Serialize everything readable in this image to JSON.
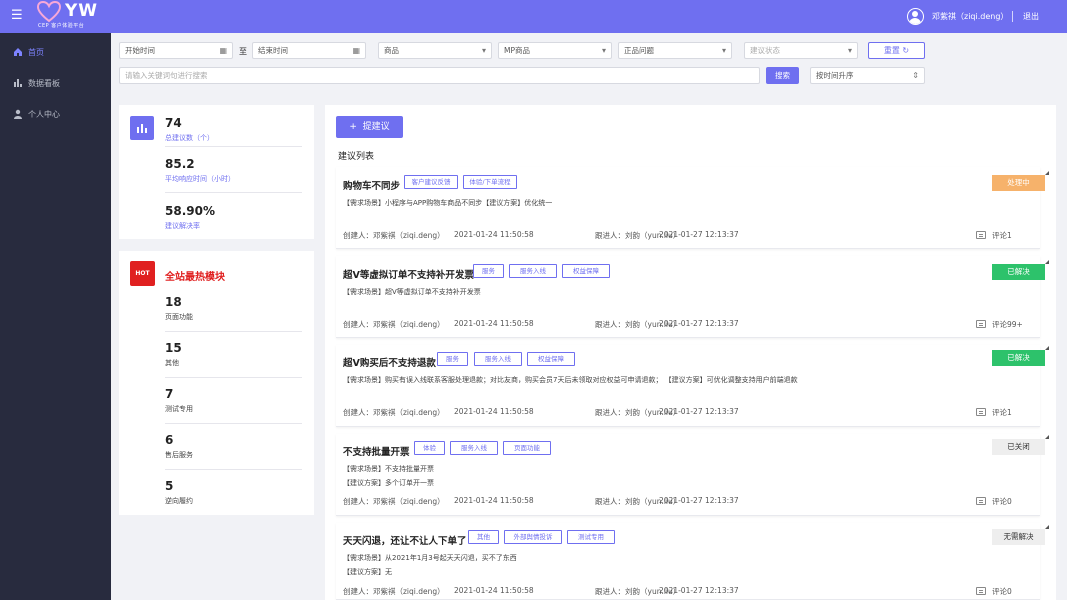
{
  "header": {
    "logo_text": "YW",
    "logo_sub": "CEP 客户体验平台",
    "user_name": "邓紫祺（ziqi.deng）",
    "logout": "退出"
  },
  "sidebar": {
    "items": [
      {
        "label": "首页",
        "icon": "home-icon",
        "active": true
      },
      {
        "label": "数据看板",
        "icon": "bar-chart-icon",
        "active": false
      },
      {
        "label": "个人中心",
        "icon": "user-icon",
        "active": false
      }
    ]
  },
  "filters": {
    "start_time": "开始时间",
    "to": "至",
    "end_time": "结束时间",
    "product": "商品",
    "mp_product": "MP商品",
    "issue_type": "正品问题",
    "status_placeholder": "建议状态",
    "reset": "重置",
    "search_placeholder": "请输入关键词句进行搜索",
    "search": "搜索",
    "sort": "按时间升序"
  },
  "stats": {
    "items": [
      {
        "value": "74",
        "label": "总建议数（个）"
      },
      {
        "value": "85.2",
        "label": "平均响应时间（小时）"
      },
      {
        "value": "58.90%",
        "label": "建议解决率"
      }
    ]
  },
  "hot": {
    "badge": "HOT",
    "title": "全站最热模块",
    "items": [
      {
        "value": "18",
        "label": "页面功能"
      },
      {
        "value": "15",
        "label": "其他"
      },
      {
        "value": "7",
        "label": "测试专用"
      },
      {
        "value": "6",
        "label": "售后服务"
      },
      {
        "value": "5",
        "label": "逆向履约"
      }
    ]
  },
  "list": {
    "add_button": "提建议",
    "title": "建议列表",
    "cards": [
      {
        "title": "购物车不同步",
        "tags": [
          "客户建议反馈",
          "体验/下单流程"
        ],
        "lines": [
          "【需求场景】小程序与APP购物车商品不同步【建议方案】优化统一"
        ],
        "creator": "创建人：邓紫祺（ziqi.deng）",
        "created": "2021-01-24  11:50:58",
        "follower": "跟进人：刘韵（yun.liu）",
        "followed": "2021-01-27  12:13:37",
        "comments": "评论1",
        "status": "处理中",
        "status_type": "processing"
      },
      {
        "title": "超V等虚拟订单不支持补开发票",
        "tags": [
          "服务",
          "服务入线",
          "权益保障"
        ],
        "lines": [
          "【需求场景】超V等虚拟订单不支持补开发票"
        ],
        "creator": "创建人：邓紫祺（ziqi.deng）",
        "created": "2021-01-24  11:50:58",
        "follower": "跟进人：刘韵（yun.liu）",
        "followed": "2021-01-27  12:13:37",
        "comments": "评论99+",
        "status": "已解决",
        "status_type": "solved"
      },
      {
        "title": "超V购买后不支持退款",
        "tags": [
          "服务",
          "服务入线",
          "权益保障"
        ],
        "lines": [
          "【需求场景】购买有误入线联系客服处理退款；对比友商，购买会员7天后未领取对应权益可申请退款；  【建议方案】可优化调整支持用户前端退款"
        ],
        "creator": "创建人：邓紫祺（ziqi.deng）",
        "created": "2021-01-24  11:50:58",
        "follower": "跟进人：刘韵（yun.liu）",
        "followed": "2021-01-27  12:13:37",
        "comments": "评论1",
        "status": "已解决",
        "status_type": "solved"
      },
      {
        "title": "不支持批量开票",
        "tags": [
          "体验",
          "服务入线",
          "页面功能"
        ],
        "lines": [
          "【需求场景】不支持批量开票",
          "【建议方案】多个订单开一票"
        ],
        "creator": "创建人：邓紫祺（ziqi.deng）",
        "created": "2021-01-24  11:50:58",
        "follower": "跟进人：刘韵（yun.liu）",
        "followed": "2021-01-27  12:13:37",
        "comments": "评论0",
        "status": "已关闭",
        "status_type": "closed"
      },
      {
        "title": "天天闪退，还让不让人下单了",
        "tags": [
          "其他",
          "外部舆情投诉",
          "测试专用"
        ],
        "lines": [
          "【需求场景】从2021年1月3号起天天闪退，买不了东西",
          "【建议方案】无"
        ],
        "creator": "创建人：邓紫祺（ziqi.deng）",
        "created": "2021-01-24  11:50:58",
        "follower": "跟进人：刘韵（yun.liu）",
        "followed": "2021-01-27  12:13:37",
        "comments": "评论0",
        "status": "无需解决",
        "status_type": "unsolvable"
      }
    ]
  }
}
